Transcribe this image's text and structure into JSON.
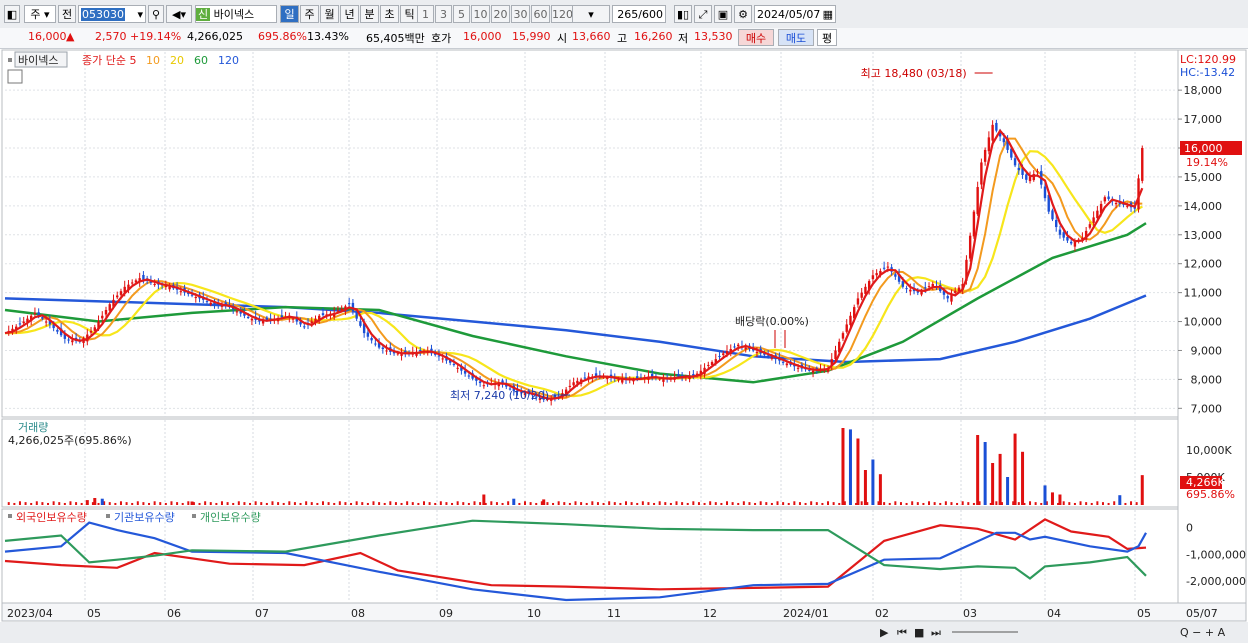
{
  "toolbar": {
    "market": "주",
    "prev": "전",
    "code": "053030",
    "stock_badge": "신",
    "stock_name": "바이넥스",
    "periods": [
      "일",
      "주",
      "월",
      "년",
      "분",
      "초",
      "틱"
    ],
    "selected_period": "일",
    "intervals": [
      "1",
      "3",
      "5",
      "10",
      "20",
      "30",
      "60",
      "120"
    ],
    "count_value": "265",
    "count_total": "/600",
    "date": "2024/05/07"
  },
  "quote": {
    "price": "16,000",
    "arrow": "▲",
    "change": "2,570",
    "change_pct": "+19.14%",
    "volume": "4,266,025",
    "vol_ratio": "695.86%",
    "turnover": "13.43%",
    "amount": "65,405백만",
    "hoga_label": "호가",
    "ask": "16,000",
    "bid": "15,990",
    "open_label": "시",
    "open": "13,660",
    "high_label": "고",
    "high": "16,260",
    "low_label": "저",
    "low": "13,530",
    "buy_label": "매수",
    "sell_label": "매도",
    "eval_label": "평"
  },
  "colors": {
    "up": "#e01010",
    "down": "#1a4fd6",
    "ma5": "#e01a1a",
    "ma10": "#f39a1e",
    "ma20": "#f7e61b",
    "ma60": "#1e9a3a",
    "ma120": "#2458d9",
    "foreign": "#e01a1a",
    "institution": "#2458d9",
    "individual": "#2e9a5c"
  },
  "chart_data": [
    {
      "type": "candlestick",
      "title": "바이넥스",
      "legend": [
        {
          "name": "종가 단순 5",
          "color": "#e01a1a"
        },
        {
          "name": "10",
          "color": "#f39a1e"
        },
        {
          "name": "20",
          "color": "#e8c800"
        },
        {
          "name": "60",
          "color": "#1e9a3a"
        },
        {
          "name": "120",
          "color": "#2458d9"
        }
      ],
      "lc": "LC:120.99",
      "hc": "HC:-13.42",
      "ylim": [
        6700,
        18800
      ],
      "yticks": [
        7000,
        8000,
        9000,
        10000,
        11000,
        12000,
        13000,
        14000,
        15000,
        16000,
        17000,
        18000
      ],
      "ytick_labels": [
        "7,000",
        "8,000",
        "9,000",
        "10,000",
        "11,000",
        "12,000",
        "13,000",
        "14,000",
        "15,000",
        "16,000",
        "17,000",
        "18,000"
      ],
      "x_labels": [
        "2023/04",
        "05",
        "06",
        "07",
        "08",
        "09",
        "10",
        "11",
        "12",
        "2024/01",
        "02",
        "03",
        "04",
        "05",
        "05/07"
      ],
      "last_price_label": "16,000",
      "last_pct_label": "19.14%",
      "annotations": {
        "high": "최고 18,480 (03/18)",
        "low": "최저 7,240 (10/20)",
        "dividend": "배당락(0.00%)"
      },
      "close_path": [
        [
          0,
          9600
        ],
        [
          8,
          9900
        ],
        [
          16,
          10300
        ],
        [
          24,
          9900
        ],
        [
          32,
          9400
        ],
        [
          40,
          9300
        ],
        [
          48,
          9800
        ],
        [
          56,
          10600
        ],
        [
          64,
          11200
        ],
        [
          72,
          11500
        ],
        [
          80,
          11300
        ],
        [
          88,
          11200
        ],
        [
          96,
          11000
        ],
        [
          104,
          10800
        ],
        [
          112,
          10600
        ],
        [
          120,
          10500
        ],
        [
          128,
          10200
        ],
        [
          136,
          10000
        ],
        [
          144,
          10100
        ],
        [
          152,
          10200
        ],
        [
          160,
          9800
        ],
        [
          168,
          10200
        ],
        [
          176,
          10300
        ],
        [
          184,
          10600
        ],
        [
          192,
          9600
        ],
        [
          200,
          9100
        ],
        [
          208,
          8900
        ],
        [
          216,
          8900
        ],
        [
          224,
          9000
        ],
        [
          232,
          8800
        ],
        [
          240,
          8500
        ],
        [
          248,
          8100
        ],
        [
          256,
          7800
        ],
        [
          264,
          7900
        ],
        [
          272,
          7600
        ],
        [
          280,
          7500
        ],
        [
          288,
          7300
        ],
        [
          296,
          7400
        ],
        [
          304,
          7900
        ],
        [
          312,
          8100
        ],
        [
          320,
          8100
        ],
        [
          328,
          8000
        ],
        [
          336,
          8000
        ],
        [
          344,
          8100
        ],
        [
          352,
          8000
        ],
        [
          360,
          8100
        ],
        [
          368,
          8100
        ],
        [
          376,
          8500
        ],
        [
          384,
          8900
        ],
        [
          392,
          9200
        ],
        [
          400,
          9000
        ],
        [
          408,
          8800
        ],
        [
          416,
          8600
        ],
        [
          424,
          8400
        ],
        [
          432,
          8300
        ],
        [
          440,
          8400
        ],
        [
          448,
          9600
        ],
        [
          456,
          10800
        ],
        [
          464,
          11600
        ],
        [
          472,
          11900
        ],
        [
          480,
          11200
        ],
        [
          488,
          11000
        ],
        [
          496,
          11300
        ],
        [
          504,
          10800
        ],
        [
          512,
          11300
        ],
        [
          518,
          13800
        ],
        [
          522,
          15500
        ],
        [
          528,
          16800
        ],
        [
          534,
          16200
        ],
        [
          540,
          15400
        ],
        [
          546,
          14900
        ],
        [
          552,
          15200
        ],
        [
          558,
          13800
        ],
        [
          564,
          13000
        ],
        [
          570,
          12700
        ],
        [
          576,
          12900
        ],
        [
          582,
          13600
        ],
        [
          588,
          14300
        ],
        [
          594,
          14100
        ],
        [
          600,
          14000
        ],
        [
          604,
          13900
        ],
        [
          608,
          16000
        ]
      ],
      "ma120_path": [
        [
          0,
          10800
        ],
        [
          100,
          10600
        ],
        [
          150,
          10500
        ],
        [
          200,
          10300
        ],
        [
          250,
          10000
        ],
        [
          300,
          9700
        ],
        [
          350,
          9300
        ],
        [
          400,
          8800
        ],
        [
          450,
          8600
        ],
        [
          500,
          8700
        ],
        [
          540,
          9300
        ],
        [
          580,
          10100
        ],
        [
          610,
          10900
        ]
      ],
      "ma60_path": [
        [
          0,
          10400
        ],
        [
          50,
          10000
        ],
        [
          100,
          10300
        ],
        [
          150,
          10500
        ],
        [
          200,
          10400
        ],
        [
          250,
          9500
        ],
        [
          300,
          8800
        ],
        [
          350,
          8200
        ],
        [
          400,
          7900
        ],
        [
          440,
          8300
        ],
        [
          480,
          9300
        ],
        [
          520,
          10800
        ],
        [
          560,
          12200
        ],
        [
          600,
          13000
        ],
        [
          610,
          13400
        ]
      ]
    },
    {
      "type": "bar",
      "title": "거래량",
      "current_label": "4,266,025주(695.86%)",
      "yticks_labels": [
        "10,000K",
        "5,000K"
      ],
      "last_label": "4,266K",
      "last_pct": "695.86%",
      "max": 11000,
      "spikes": [
        [
          44,
          700
        ],
        [
          48,
          1000
        ],
        [
          52,
          900
        ],
        [
          100,
          500
        ],
        [
          256,
          1500
        ],
        [
          272,
          900
        ],
        [
          288,
          800
        ],
        [
          448,
          11000
        ],
        [
          452,
          10800
        ],
        [
          456,
          9500
        ],
        [
          460,
          5000
        ],
        [
          464,
          6500
        ],
        [
          468,
          4400
        ],
        [
          520,
          10000
        ],
        [
          524,
          9000
        ],
        [
          528,
          6000
        ],
        [
          532,
          7300
        ],
        [
          536,
          4000
        ],
        [
          540,
          10200
        ],
        [
          544,
          7600
        ],
        [
          556,
          2800
        ],
        [
          560,
          1800
        ],
        [
          564,
          1500
        ],
        [
          596,
          1400
        ],
        [
          608,
          4266
        ]
      ]
    },
    {
      "type": "line",
      "legend": [
        "외국인보유수량",
        "기관보유수량",
        "개인보유수량"
      ],
      "ylim": [
        -2700000,
        500000
      ],
      "yticks": [
        0,
        -1000000,
        -2000000
      ],
      "ytick_labels": [
        "0",
        "-1,000,000",
        "-2,000,000"
      ],
      "series": [
        {
          "name": "외국인보유수량",
          "color": "#e01a1a",
          "values": [
            [
              0,
              -1250000
            ],
            [
              30,
              -1400000
            ],
            [
              60,
              -1500000
            ],
            [
              80,
              -950000
            ],
            [
              120,
              -1350000
            ],
            [
              160,
              -1400000
            ],
            [
              190,
              -950000
            ],
            [
              210,
              -1600000
            ],
            [
              260,
              -2150000
            ],
            [
              300,
              -2200000
            ],
            [
              350,
              -2300000
            ],
            [
              400,
              -2250000
            ],
            [
              440,
              -2200000
            ],
            [
              470,
              -500000
            ],
            [
              500,
              80000
            ],
            [
              520,
              -50000
            ],
            [
              540,
              -450000
            ],
            [
              556,
              300000
            ],
            [
              570,
              -150000
            ],
            [
              590,
              -350000
            ],
            [
              600,
              -800000
            ],
            [
              610,
              -750000
            ]
          ]
        },
        {
          "name": "기관보유수량",
          "color": "#2458d9",
          "values": [
            [
              0,
              -900000
            ],
            [
              30,
              -700000
            ],
            [
              45,
              180000
            ],
            [
              60,
              -100000
            ],
            [
              80,
              -400000
            ],
            [
              100,
              -900000
            ],
            [
              150,
              -950000
            ],
            [
              200,
              -1650000
            ],
            [
              250,
              -2300000
            ],
            [
              300,
              -2700000
            ],
            [
              350,
              -2600000
            ],
            [
              400,
              -2150000
            ],
            [
              440,
              -2100000
            ],
            [
              470,
              -1200000
            ],
            [
              500,
              -1150000
            ],
            [
              530,
              -200000
            ],
            [
              540,
              -200000
            ],
            [
              548,
              -450000
            ],
            [
              556,
              -350000
            ],
            [
              580,
              -700000
            ],
            [
              600,
              -900000
            ],
            [
              606,
              -700000
            ],
            [
              610,
              -200000
            ]
          ]
        },
        {
          "name": "개인보유수량",
          "color": "#2e9a5c",
          "values": [
            [
              0,
              -500000
            ],
            [
              30,
              -300000
            ],
            [
              45,
              -1300000
            ],
            [
              60,
              -1200000
            ],
            [
              80,
              -1050000
            ],
            [
              100,
              -850000
            ],
            [
              150,
              -900000
            ],
            [
              200,
              -300000
            ],
            [
              250,
              250000
            ],
            [
              300,
              120000
            ],
            [
              350,
              -50000
            ],
            [
              400,
              -100000
            ],
            [
              440,
              -100000
            ],
            [
              470,
              -1400000
            ],
            [
              500,
              -1550000
            ],
            [
              520,
              -1450000
            ],
            [
              540,
              -1500000
            ],
            [
              548,
              -1900000
            ],
            [
              556,
              -1450000
            ],
            [
              580,
              -1300000
            ],
            [
              600,
              -1100000
            ],
            [
              610,
              -1800000
            ]
          ]
        }
      ]
    }
  ]
}
